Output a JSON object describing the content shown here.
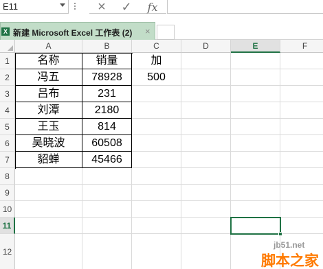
{
  "formula_bar": {
    "name_box": "E11",
    "cancel_icon": "×",
    "enter_icon": "✓",
    "fx_label": "fx",
    "formula": ""
  },
  "document_tab": {
    "icon_letter": "X",
    "title": "新建 Microsoft Excel 工作表 (2)",
    "close_icon": "×"
  },
  "grid": {
    "columns": [
      "A",
      "B",
      "C",
      "D",
      "E",
      "F"
    ],
    "selected_column": "E",
    "rows": [
      "1",
      "2",
      "3",
      "4",
      "5",
      "6",
      "7",
      "8",
      "9",
      "10",
      "11",
      "12"
    ],
    "selected_row": "11",
    "cells": {
      "A1": "名称",
      "B1": "销量",
      "C1": "加",
      "A2": "冯五",
      "B2": "78928",
      "C2": "500",
      "A3": "吕布",
      "B3": "231",
      "A4": "刘潭",
      "B4": "2180",
      "A5": "王玉",
      "B5": "814",
      "A6": "吴晓波",
      "B6": "60508",
      "A7": "貂蝉",
      "B7": "45466"
    }
  },
  "watermark": {
    "url": "jb51.net",
    "name": "脚本之家"
  }
}
